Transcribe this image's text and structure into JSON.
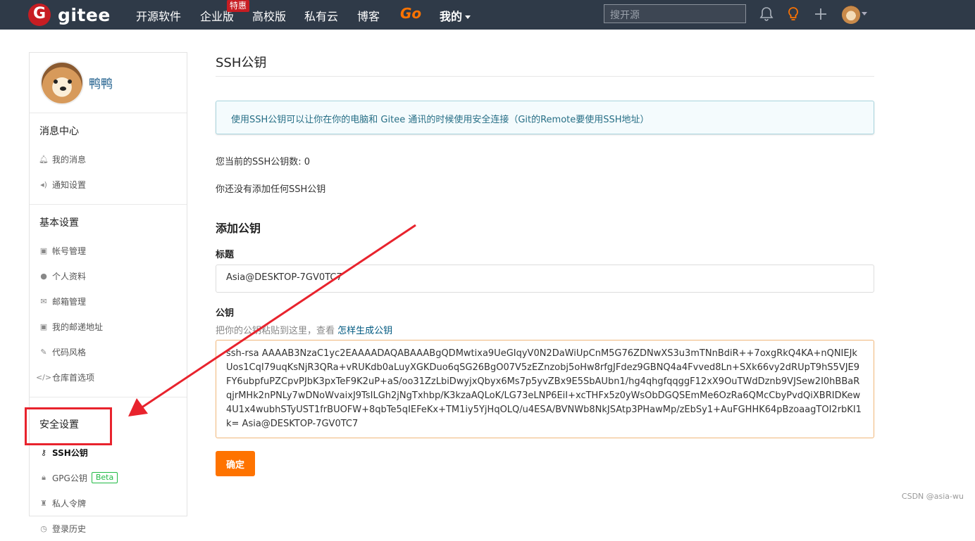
{
  "nav": {
    "logo_text": "gitee",
    "items": [
      "开源软件",
      "企业版",
      "高校版",
      "私有云",
      "博客"
    ],
    "badge": "特惠",
    "go_label": "Go",
    "mine_label": "我的",
    "search_placeholder": "搜开源"
  },
  "sidebar": {
    "username": "鸭鸭",
    "sections": [
      {
        "title": "消息中心",
        "items": [
          "我的消息",
          "通知设置"
        ]
      },
      {
        "title": "基本设置",
        "items": [
          "帐号管理",
          "个人资料",
          "邮箱管理",
          "我的邮递地址",
          "代码风格",
          "仓库首选项"
        ]
      },
      {
        "title": "安全设置",
        "items": [
          "SSH公钥",
          "GPG公钥",
          "私人令牌",
          "登录历史"
        ]
      }
    ],
    "beta_label": "Beta",
    "active_item": "SSH公钥"
  },
  "main": {
    "title": "SSH公钥",
    "info": "使用SSH公钥可以让你在你的电脑和 Gitee 通讯的时候使用安全连接（Git的Remote要使用SSH地址）",
    "count_text": "您当前的SSH公钥数: 0",
    "empty_text": "你还没有添加任何SSH公钥",
    "add_heading": "添加公钥",
    "title_label": "标题",
    "title_value": "Asia@DESKTOP-7GV0TC7",
    "key_label": "公钥",
    "key_hint": "把你的公钥粘贴到这里，查看",
    "key_hint_link": "怎样生成公钥",
    "key_value": "ssh-rsa AAAAB3NzaC1yc2EAAAADAQABAAABgQDMwtixa9UeGIqyV0N2DaWiUpCnM5G76ZDNwXS3u3mTNnBdiR++7oxgRkQ4KA+nQNIEJkUos1CqI79uqKsNjR3QRa+vRUKdb0aLuyXGKDuo6qSG26BgO07V5zEZnzobj5oHw8rfgJFdez9GBNQ4a4Fvved8Ln+SXk66vy2dRUpT9hS5VJE9FY6ubpfuPZCpvPJbK3pxTeF9K2uP+aS/oo31ZzLbiDwyjxQbyx6Ms7p5yvZBx9E5SbAUbn1/hg4qhgfqqggF12xX9OuTWdDznb9VJSew2I0hBBaRqjrMHk2nPNLy7wDNoWvaixJ9TsILGh2jNgTxhbp/K3kzaAQLoK/LG73eLNP6EiI+xcTHFx5z0yWsObDGQSEmMe6OzRa6QMcCbyPvdQiXBRIDKew4U1x4wubhSTyUST1frBUOFW+8qbTe5qIEFeKx+TM1iy5YjHqOLQ/u4ESA/BVNWb8NkJSAtp3PHawMp/zEbSy1+AuFGHHK64pBzoaagTOI2rbKI1k= Asia@DESKTOP-7GV0TC7",
    "confirm_label": "确定"
  },
  "watermark": "CSDN @asia-wu",
  "colors": {
    "nav_bg": "#2f3a48",
    "accent": "#fe7300",
    "brand": "#c71d23",
    "annotation": "#e8232d"
  }
}
